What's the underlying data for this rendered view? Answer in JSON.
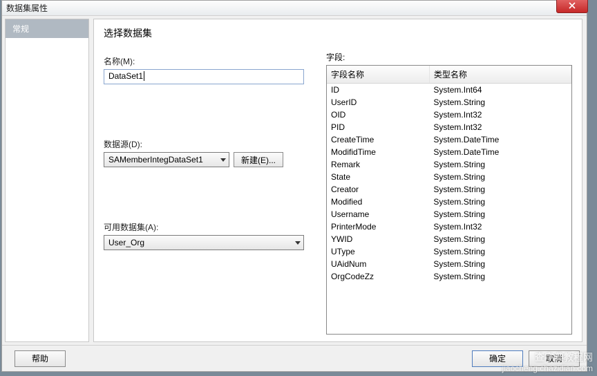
{
  "window": {
    "title": "数据集属性"
  },
  "sidebar": {
    "items": [
      {
        "label": "常规",
        "active": true
      }
    ]
  },
  "main": {
    "heading": "选择数据集",
    "name_label": "名称(M):",
    "name_value": "DataSet1",
    "datasource_label": "数据源(D):",
    "datasource_value": "SAMemberIntegDataSet1",
    "new_button": "新建(E)...",
    "available_label": "可用数据集(A):",
    "available_value": "User_Org",
    "fields_label": "字段:",
    "columns": {
      "name": "字段名称",
      "type": "类型名称"
    },
    "fields": [
      {
        "name": "ID",
        "type": "System.Int64"
      },
      {
        "name": "UserID",
        "type": "System.String"
      },
      {
        "name": "OID",
        "type": "System.Int32"
      },
      {
        "name": "PID",
        "type": "System.Int32"
      },
      {
        "name": "CreateTime",
        "type": "System.DateTime"
      },
      {
        "name": "ModifidTime",
        "type": "System.DateTime"
      },
      {
        "name": "Remark",
        "type": "System.String"
      },
      {
        "name": "State",
        "type": "System.String"
      },
      {
        "name": "Creator",
        "type": "System.String"
      },
      {
        "name": "Modified",
        "type": "System.String"
      },
      {
        "name": "Username",
        "type": "System.String"
      },
      {
        "name": "PrinterMode",
        "type": "System.Int32"
      },
      {
        "name": "YWID",
        "type": "System.String"
      },
      {
        "name": "UType",
        "type": "System.String"
      },
      {
        "name": "UAidNum",
        "type": "System.String"
      },
      {
        "name": "OrgCodeZz",
        "type": "System.String"
      }
    ]
  },
  "footer": {
    "help": "帮助",
    "ok": "确定",
    "cancel": "取消"
  },
  "watermark": {
    "line1": "查字典教程网",
    "line2": "jiaocheng.chazidian.com"
  }
}
